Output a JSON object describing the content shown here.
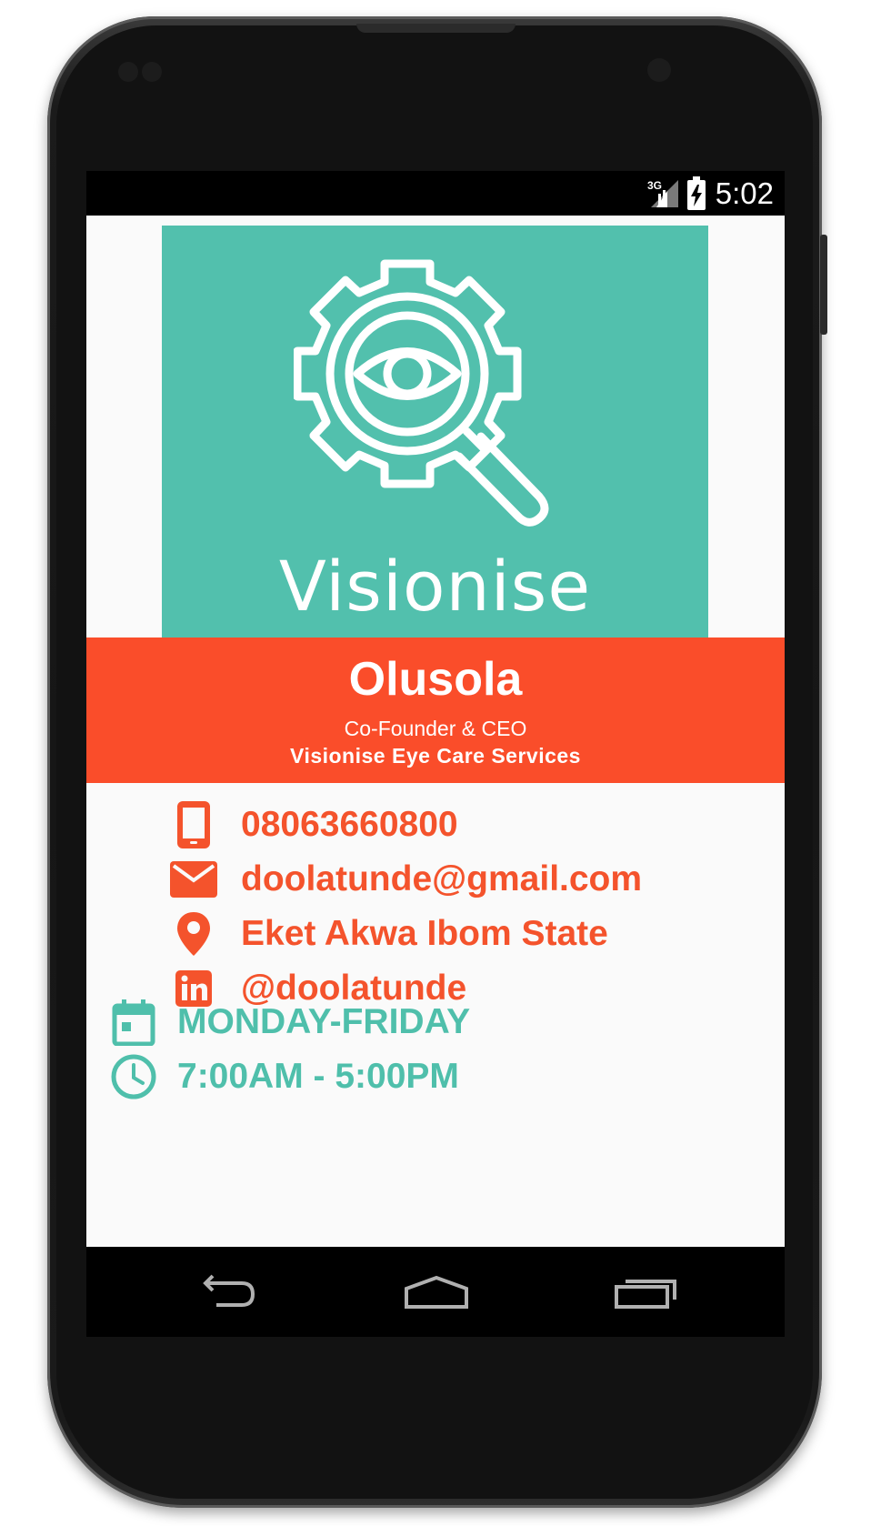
{
  "status_bar": {
    "network": "3G",
    "time": "5:02"
  },
  "hero": {
    "brand": "Visionise",
    "logo_icon": "gear-eye-magnifier-icon"
  },
  "profile": {
    "name": "Olusola",
    "role": "Co-Founder & CEO",
    "company": "Visionise Eye Care Services"
  },
  "contacts": [
    {
      "icon": "phone-icon",
      "value": "08063660800"
    },
    {
      "icon": "email-icon",
      "value": "doolatunde@gmail.com"
    },
    {
      "icon": "location-pin-icon",
      "value": "Eket Akwa Ibom State"
    },
    {
      "icon": "linkedin-icon",
      "value": "@doolatunde"
    }
  ],
  "hours": {
    "days": "MONDAY-FRIDAY",
    "time": "7:00AM - 5:00PM"
  },
  "navigation": [
    "back",
    "home",
    "recents"
  ],
  "colors": {
    "teal": "#52c0ad",
    "orange": "#fa4d2a",
    "contact_text": "#f4532c",
    "hours_text": "#4fbfab"
  }
}
